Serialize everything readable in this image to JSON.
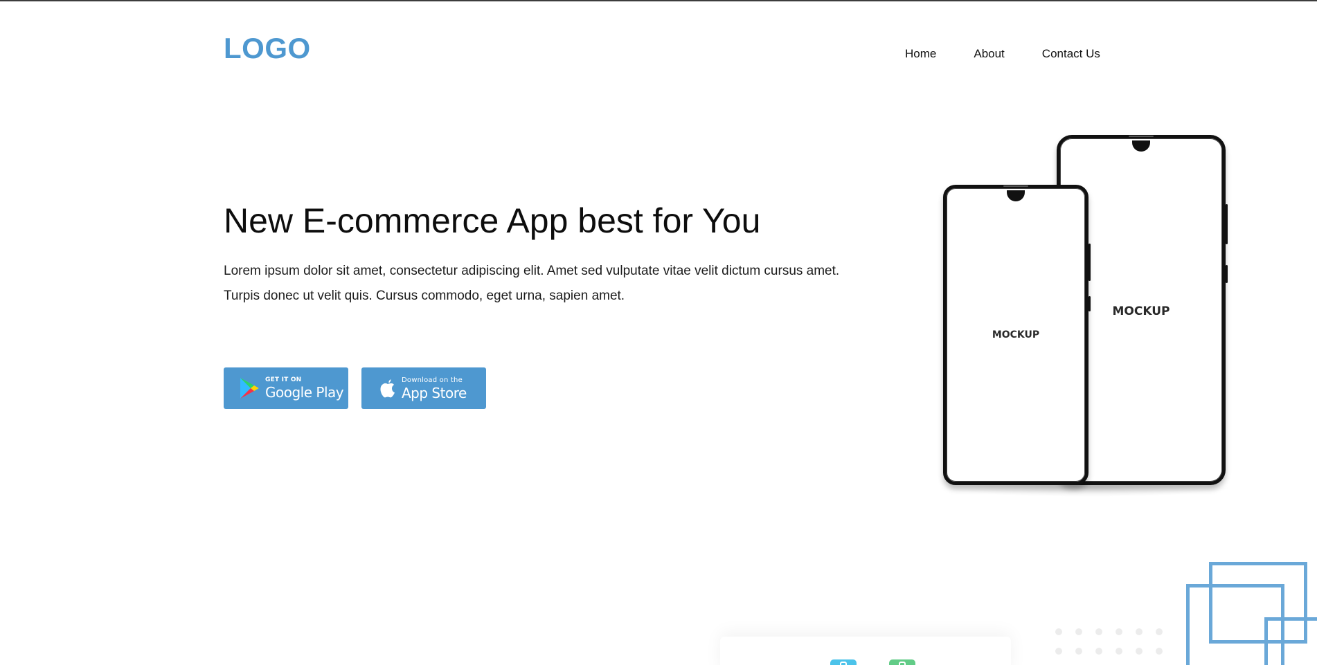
{
  "header": {
    "logo": "LOGO",
    "nav": {
      "home": "Home",
      "about": "About",
      "contact": "Contact Us"
    }
  },
  "hero": {
    "title": "New E-commerce App best for You",
    "description": "Lorem ipsum dolor sit amet, consectetur adipiscing elit. Amet sed vulputate vitae velit dictum cursus amet. Turpis donec ut velit quis. Cursus commodo, eget urna, sapien amet."
  },
  "store_buttons": {
    "google_play": {
      "small": "GET IT ON",
      "big": "Google Play",
      "icon": "google-play-icon"
    },
    "app_store": {
      "small": "Download on the",
      "big": "App Store",
      "icon": "apple-icon"
    }
  },
  "mockups": {
    "large_label": "MOCKUP",
    "small_label": "MOCKUP"
  },
  "colors": {
    "accent": "#4e98d0",
    "decoration": "#6aa8d8",
    "mini_icon_blue": "#4cc3ea",
    "mini_icon_green": "#62cc87"
  }
}
